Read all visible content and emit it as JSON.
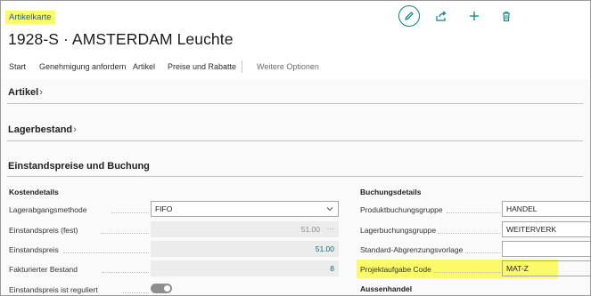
{
  "header": {
    "card_type": "Artikelkarte",
    "title": "1928-S · AMSTERDAM Leuchte",
    "icons": [
      "edit-icon",
      "share-icon",
      "add-icon",
      "delete-icon"
    ],
    "accent_color": "#008489",
    "highlight_color": "#fbfb6a"
  },
  "actions": {
    "items": [
      "Start",
      "Genehmigung anfordern",
      "Artikel",
      "Preise und Rabatte"
    ],
    "more": "Weitere Optionen"
  },
  "sections": {
    "artikel": "Artikel",
    "lagerbestand": "Lagerbestand",
    "einstandspreise": "Einstandspreise und Buchung"
  },
  "kosten": {
    "heading": "Kostendetails",
    "fields": [
      {
        "label": "Lagerabgangsmethode",
        "value": "FIFO"
      },
      {
        "label": "Einstandspreis (fest)",
        "value": "51.00"
      },
      {
        "label": "Einstandspreis",
        "value": "51.00"
      },
      {
        "label": "Fakturierter Bestand",
        "value": "8"
      },
      {
        "label": "Einstandspreis ist reguliert",
        "value": ""
      }
    ]
  },
  "buchung": {
    "heading": "Buchungsdetails",
    "fields": [
      {
        "label": "Produktbuchungsgruppe",
        "value": "HANDEL"
      },
      {
        "label": "Lagerbuchungsgruppe",
        "value": "WEITERVERK"
      },
      {
        "label": "Standard-Abgrenzungsvorlage",
        "value": ""
      },
      {
        "label": "Projektaufgabe Code",
        "value": "MAT-Z"
      }
    ],
    "next_heading": "Aussenhandel"
  }
}
